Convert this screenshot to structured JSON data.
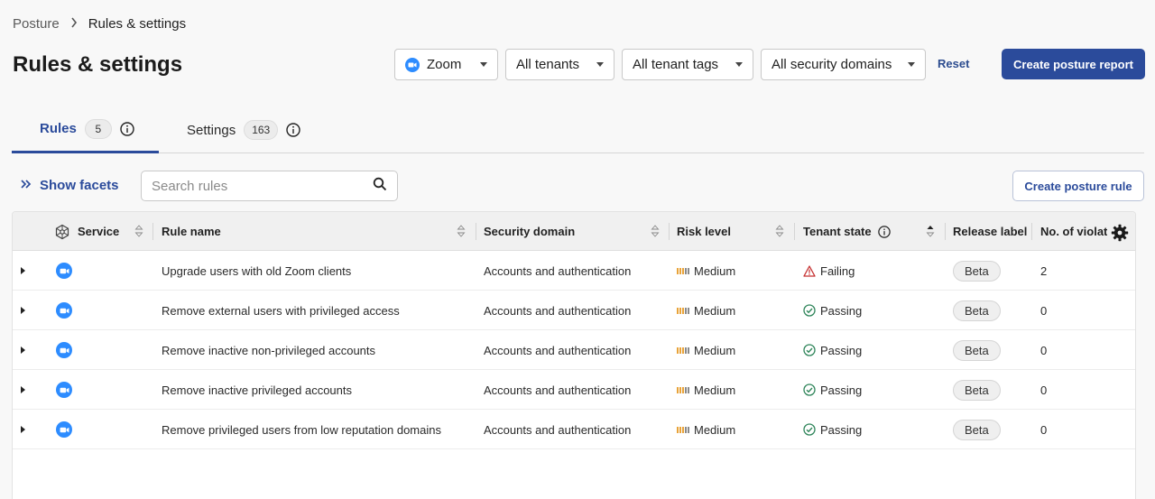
{
  "breadcrumb": {
    "parent": "Posture",
    "current": "Rules & settings"
  },
  "page": {
    "title": "Rules & settings"
  },
  "filters": {
    "service": "Zoom",
    "tenants": "All tenants",
    "tenant_tags": "All tenant tags",
    "security_domains": "All security domains",
    "reset_label": "Reset"
  },
  "actions": {
    "create_report": "Create posture report",
    "create_rule": "Create posture rule"
  },
  "tabs": [
    {
      "label": "Rules",
      "count": "5",
      "active": true
    },
    {
      "label": "Settings",
      "count": "163",
      "active": false
    }
  ],
  "toolbar": {
    "show_facets": "Show facets",
    "search_placeholder": "Search rules"
  },
  "table": {
    "columns": {
      "service": "Service",
      "rule_name": "Rule name",
      "security_domain": "Security domain",
      "risk_level": "Risk level",
      "tenant_state": "Tenant state",
      "release_label": "Release label",
      "violations": "No. of violat"
    },
    "rows": [
      {
        "rule_name": "Upgrade users with old Zoom clients",
        "security_domain": "Accounts and authentication",
        "risk_level": "Medium",
        "tenant_state": "Failing",
        "release_label": "Beta",
        "violations": "2"
      },
      {
        "rule_name": "Remove external users with privileged access",
        "security_domain": "Accounts and authentication",
        "risk_level": "Medium",
        "tenant_state": "Passing",
        "release_label": "Beta",
        "violations": "0"
      },
      {
        "rule_name": "Remove inactive non-privileged accounts",
        "security_domain": "Accounts and authentication",
        "risk_level": "Medium",
        "tenant_state": "Passing",
        "release_label": "Beta",
        "violations": "0"
      },
      {
        "rule_name": "Remove inactive privileged accounts",
        "security_domain": "Accounts and authentication",
        "risk_level": "Medium",
        "tenant_state": "Passing",
        "release_label": "Beta",
        "violations": "0"
      },
      {
        "rule_name": "Remove privileged users from low reputation domains",
        "security_domain": "Accounts and authentication",
        "risk_level": "Medium",
        "tenant_state": "Passing",
        "release_label": "Beta",
        "violations": "0"
      }
    ]
  },
  "colors": {
    "primary": "#2b4b9b",
    "zoom_blue": "#2d8cff",
    "risk_bar_filled": "#e8a33a",
    "risk_bar_empty": "#8a8a8a",
    "failing": "#c53030",
    "passing": "#2f855a"
  },
  "icons": {
    "breadcrumb_separator": "chevron-right-icon",
    "zoom": "zoom-camera-icon",
    "info": "info-icon",
    "facets": "double-chevron-right-icon",
    "search": "search-icon",
    "service_header": "service-hub-icon",
    "settings": "gear-icon",
    "failing": "warning-triangle-icon",
    "passing": "check-circle-icon"
  }
}
